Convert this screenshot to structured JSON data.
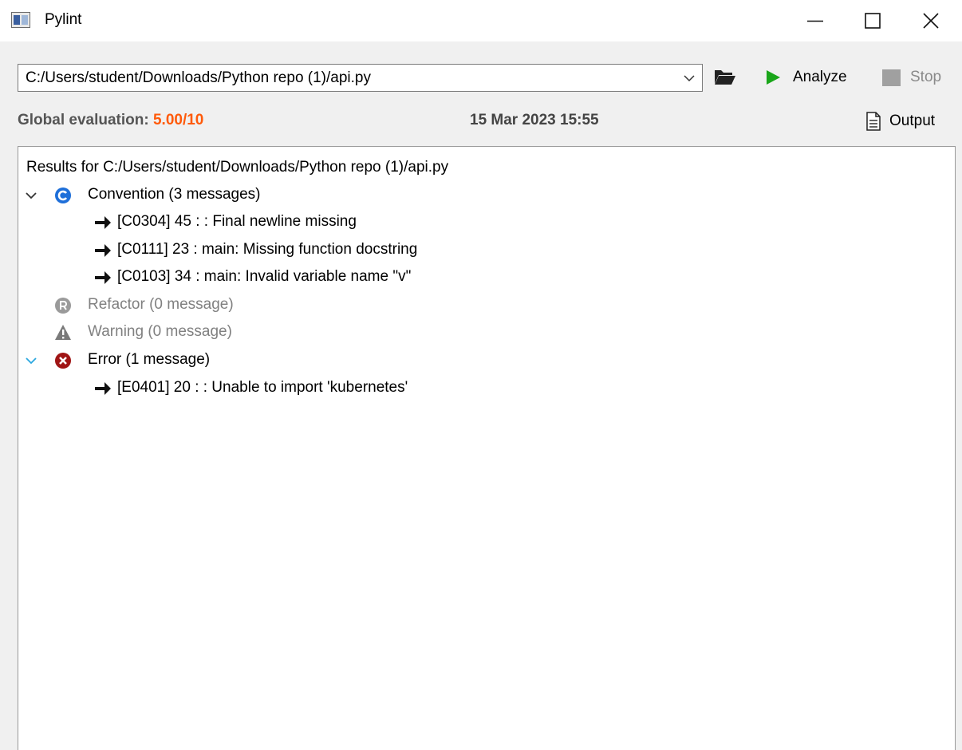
{
  "window": {
    "title": "Pylint",
    "minimize_icon": "minimize-icon",
    "maximize_icon": "maximize-icon",
    "close_icon": "close-icon"
  },
  "toolbar": {
    "file_path": "C:/Users/student/Downloads/Python repo (1)/api.py",
    "analyze_label": "Analyze",
    "stop_label": "Stop",
    "folder_icon": "folder-open-icon",
    "play_icon": "play-icon",
    "stop_icon": "stop-icon"
  },
  "evaluation": {
    "label": "Global evaluation:",
    "score": "5.00/10",
    "date": "15 Mar 2023 15:55",
    "output_label": "Output",
    "score_color": "#ff5a0a"
  },
  "results": {
    "header": "Results for C:/Users/student/Downloads/Python repo (1)/api.py",
    "categories": [
      {
        "label": "Convention (3 messages)",
        "icon": "convention-icon",
        "expanded": true,
        "messages": [
          "[C0304] 45 :  : Final newline missing",
          "[C0111] 23 :  main: Missing function docstring",
          "[C0103] 34 :  main: Invalid variable name \"v\""
        ]
      },
      {
        "label": "Refactor (0 message)",
        "icon": "refactor-icon",
        "expanded": false,
        "messages": []
      },
      {
        "label": "Warning (0 message)",
        "icon": "warning-icon",
        "expanded": false,
        "messages": []
      },
      {
        "label": "Error (1 message)",
        "icon": "error-icon",
        "expanded": true,
        "messages": [
          "[E0401] 20 :  : Unable to import 'kubernetes'"
        ]
      }
    ]
  },
  "colors": {
    "convention": "#1e6fd9",
    "error": "#a01515",
    "play": "#1aa61a",
    "expander_active": "#2aa7e0"
  }
}
